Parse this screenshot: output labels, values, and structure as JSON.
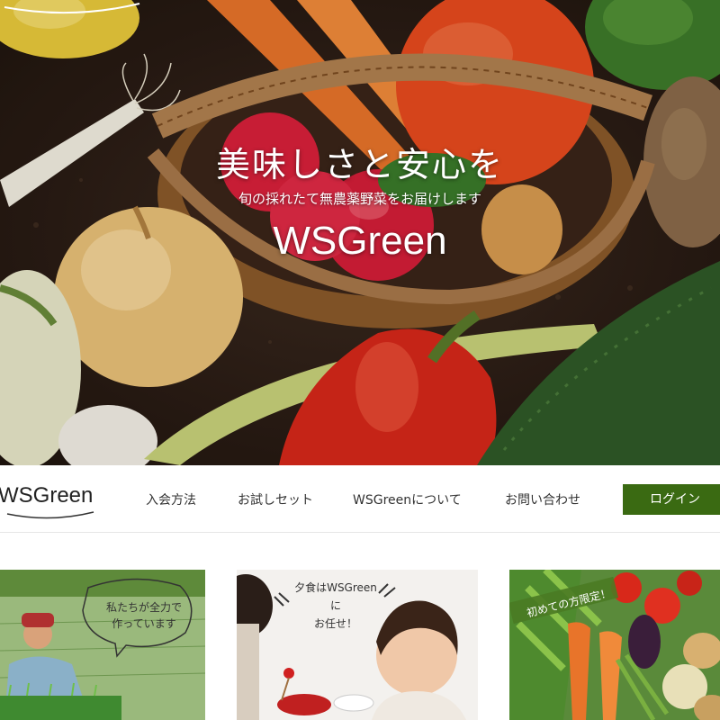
{
  "hero": {
    "title": "美味しさと安心を",
    "subtitle": "旬の採れたて無農薬野菜をお届けします",
    "logo": "WSGreen"
  },
  "nav": {
    "logo": "WSGreen",
    "links": [
      "入会方法",
      "お試しセット",
      "WSGreenについて",
      "お問い合わせ"
    ],
    "login": "ログイン"
  },
  "cards": [
    {
      "bubble": "私たちが全力で\n作っています"
    },
    {
      "bubble": "夕食はWSGreenに\nお任せ！"
    },
    {
      "bubble": "初めての方限定！"
    }
  ],
  "colors": {
    "accent": "#3a6a12"
  }
}
